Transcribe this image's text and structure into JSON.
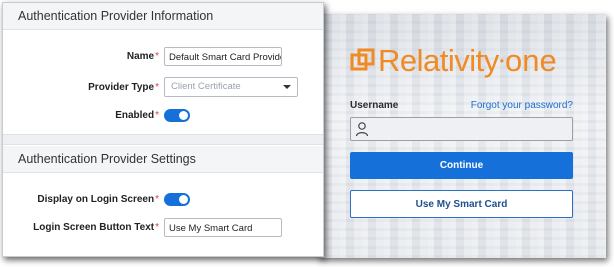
{
  "login": {
    "logo_text": "Relativity",
    "logo_suffix": "one",
    "username_label": "Username",
    "forgot_password": "Forgot your password?",
    "username_value": "",
    "continue_button": "Continue",
    "smart_card_button": "Use My Smart Card",
    "icons": {
      "logo": "relativity-logo-icon",
      "user": "user-icon"
    },
    "colors": {
      "brand_orange": "#f08a24",
      "primary_blue": "#1670d9"
    }
  },
  "settings": {
    "info_section_title": "Authentication Provider Information",
    "settings_section_title": "Authentication Provider Settings",
    "required_marker": "*",
    "name_label": "Name",
    "name_value": "Default Smart Card Provider",
    "provider_type_label": "Provider Type",
    "provider_type_value": "Client Certificate",
    "enabled_label": "Enabled",
    "enabled_value": true,
    "display_on_login_label": "Display on Login Screen",
    "display_on_login_value": true,
    "button_text_label": "Login Screen Button Text",
    "button_text_value": "Use My Smart Card",
    "icons": {
      "dropdown": "chevron-down-icon"
    }
  }
}
